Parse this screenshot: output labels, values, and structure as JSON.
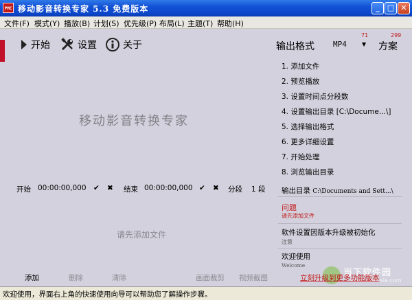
{
  "window": {
    "icon_text": "PMC",
    "title": "移动影音转换专家 5.3 免费版本",
    "controls": {
      "minimize": "_",
      "maximize": "□",
      "close": "✕"
    }
  },
  "menu": [
    {
      "label": "文件(F)"
    },
    {
      "label": "模式(Y)"
    },
    {
      "label": "播放(B)"
    },
    {
      "label": "计划(S)"
    },
    {
      "label": "优先级(P)"
    },
    {
      "label": "布局(L)"
    },
    {
      "label": "主题(T)"
    },
    {
      "label": "帮助(H)"
    }
  ],
  "toolbar": {
    "start": "开始",
    "settings": "设置",
    "about": "关于",
    "output_format_label": "输出格式",
    "format_value": "MP4",
    "format_count": "71",
    "scheme_label": "方案",
    "scheme_count": "299"
  },
  "app_name_display": "移动影音转换专家",
  "steps": [
    "1. 添加文件",
    "2. 预览播放",
    "3. 设置时间点分段数",
    "4. 设置输出目录 [C:\\Docume...\\]",
    "5. 选择输出格式",
    "6. 更多详细设置",
    "7. 开始处理",
    "8. 浏览输出目录"
  ],
  "time_row": {
    "start_label": "开始",
    "start_time": "00:00:00,000",
    "end_label": "结束",
    "end_time": "00:00:00,000",
    "segment_label": "分段",
    "segment_value": "1 段"
  },
  "output_dir": {
    "label": "输出目录",
    "path": "C:\\Documents and Sett...\\"
  },
  "messages": {
    "issue_title": "问题",
    "issue_sub": "请先添加文件",
    "notice_title": "软件设置因版本升级被初始化",
    "notice_sub": "注意",
    "welcome_title": "欢迎使用",
    "welcome_sub": "Welcome"
  },
  "file_list": {
    "empty_hint": "请先添加文件"
  },
  "bottom": {
    "add": "添加",
    "delete": "删除",
    "clear": "清除",
    "crop": "画面裁剪",
    "screenshot": "视频截图",
    "upgrade": "立刻升级到更多功能版本"
  },
  "site_watermark": {
    "name": "当下软件园",
    "url": "www.downxia.com"
  },
  "status": "欢迎使用，界面右上角的快速使用向导可以帮助您了解操作步骤。",
  "colors": {
    "accent_red": "#c11818",
    "panel_bg": "#d3d1dd",
    "titlebar_blue": "#0c46c8"
  }
}
